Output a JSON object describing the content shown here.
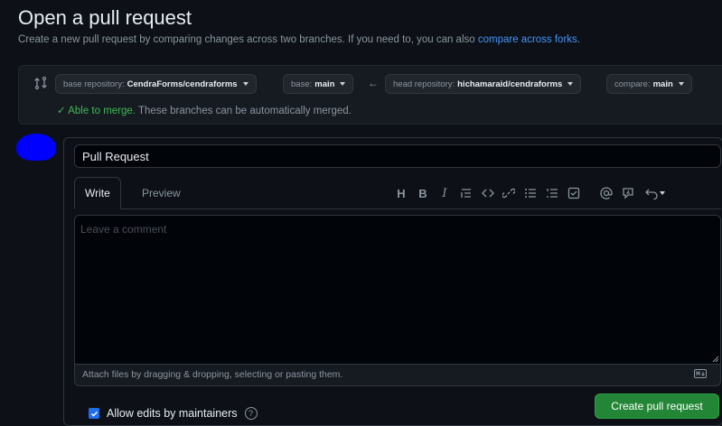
{
  "header": {
    "title": "Open a pull request",
    "subtitle": "Create a new pull request by comparing changes across two branches. If you need to, you can also",
    "forks_link": "compare across forks",
    "subtitle_end": "."
  },
  "compare": {
    "base_repo_label": "base repository:",
    "base_repo_value": "CendraForms/cendraforms",
    "base_label": "base:",
    "base_value": "main",
    "arrow": "←",
    "head_repo_label": "head repository:",
    "head_repo_value": "hichamaraid/cendraforms",
    "compare_label": "compare:",
    "compare_value": "main",
    "merge_check": "✓",
    "merge_ok": "Able to merge.",
    "merge_detail": "These branches can be automatically merged."
  },
  "form": {
    "title_value": "Pull Request",
    "tabs": [
      {
        "label": "Write",
        "active": true
      },
      {
        "label": "Preview",
        "active": false
      }
    ],
    "toolbar_icons": [
      "heading-icon",
      "bold-icon",
      "italic-icon",
      "quote-icon",
      "code-icon",
      "link-icon",
      "unordered-list-icon",
      "ordered-list-icon",
      "task-list-icon",
      "mention-icon",
      "reference-icon",
      "undo-icon"
    ],
    "heading_glyph": "H",
    "bold_glyph": "B",
    "italic_glyph": "I",
    "comment_placeholder": "Leave a comment",
    "attach_text": "Attach files by dragging & dropping, selecting or pasting them."
  },
  "footer": {
    "allow_edits_label": "Allow edits by maintainers",
    "allow_edits_checked": true,
    "help_glyph": "?",
    "create_button": "Create pull request"
  },
  "colors": {
    "background": "#0d1117",
    "accent_link": "#4493f8",
    "success": "#3fb950",
    "primary_button": "#238636",
    "avatar": "#0000ff"
  }
}
